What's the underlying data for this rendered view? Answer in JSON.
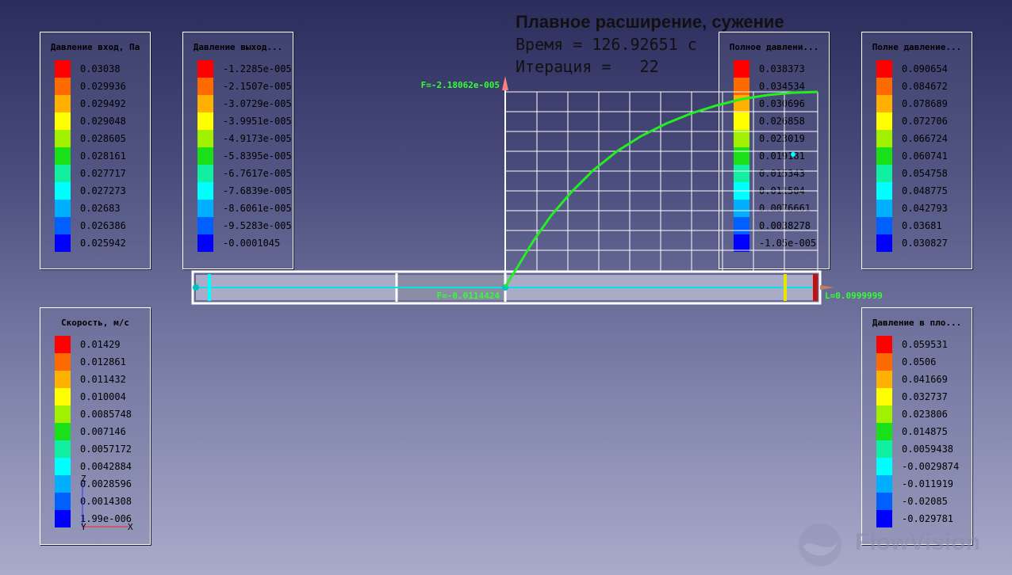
{
  "header": {
    "title": "Плавное расширение, сужение",
    "time_line": "Время = 126.92651 с",
    "iteration_line": "Итерация =   22"
  },
  "palette": [
    "#ff0000",
    "#ff6a00",
    "#ffb000",
    "#ffff00",
    "#a0f000",
    "#19e019",
    "#10f0a0",
    "#00ffff",
    "#00b0ff",
    "#0060ff",
    "#0000ff"
  ],
  "legends": {
    "inlet_pressure": {
      "title": "Давление вход, Па",
      "values": [
        "0.03038",
        "0.029936",
        "0.029492",
        "0.029048",
        "0.028605",
        "0.028161",
        "0.027717",
        "0.027273",
        "0.02683",
        "0.026386",
        "0.025942"
      ]
    },
    "outlet_pressure": {
      "title": "Давление выход...",
      "values": [
        "-1.2285e-005",
        "-2.1507e-005",
        "-3.0729e-005",
        "-3.9951e-005",
        "-4.9173e-005",
        "-5.8395e-005",
        "-6.7617e-005",
        "-7.6839e-005",
        "-8.6061e-005",
        "-9.5283e-005",
        "-0.0001045"
      ]
    },
    "total_pressure_1": {
      "title": "Полное давлени...",
      "values": [
        "0.038373",
        "0.034534",
        "0.030696",
        "0.026858",
        "0.023019",
        "0.019181",
        "0.015343",
        "0.011504",
        "0.0076661",
        "0.0038278",
        "-1.05e-005"
      ]
    },
    "total_pressure_2": {
      "title": "Полне давление...",
      "values": [
        "0.090654",
        "0.084672",
        "0.078689",
        "0.072706",
        "0.066724",
        "0.060741",
        "0.054758",
        "0.048775",
        "0.042793",
        "0.03681",
        "0.030827"
      ]
    },
    "velocity": {
      "title": "Скорость, м/с",
      "values": [
        "0.01429",
        "0.012861",
        "0.011432",
        "0.010004",
        "0.0085748",
        "0.007146",
        "0.0057172",
        "0.0042884",
        "0.0028596",
        "0.0014308",
        "1.99e-006"
      ]
    },
    "plane_pressure": {
      "title": "Давление в пло...",
      "values": [
        "0.059531",
        "0.0506",
        "0.041669",
        "0.032737",
        "0.023806",
        "0.014875",
        "0.0059438",
        "-0.0029874",
        "-0.011919",
        "-0.02085",
        "-0.029781"
      ]
    }
  },
  "graph": {
    "f_max_label": "F=-2.18062e-005",
    "f_origin_label": "F=-0.0114424",
    "length_label": "L=0.0999999"
  },
  "axes": {
    "z": "Z",
    "y": "Y",
    "x": "X"
  },
  "branding": {
    "logo_text": "FlowVision"
  }
}
